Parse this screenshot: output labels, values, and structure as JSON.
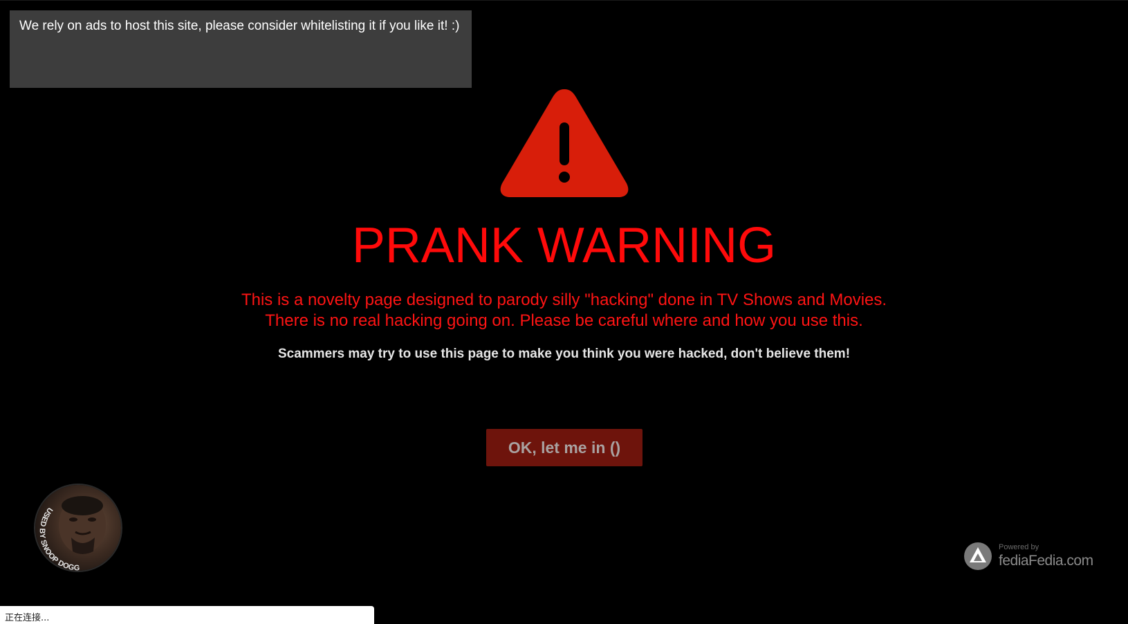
{
  "ad_notice": {
    "text": "We rely on ads to host this site, please consider whitelisting it if you like it! :)"
  },
  "warning": {
    "icon": "warning-triangle-icon",
    "title": "PRANK WARNING",
    "line1": "This is a novelty page designed to parody silly \"hacking\" done in TV Shows and Movies.",
    "line2": "There is no real hacking going on. Please be careful where and how you use this.",
    "scam_notice": "Scammers may try to use this page to make you think you were hacked, don't believe them!",
    "button_label": "OK, let me in ()"
  },
  "badge": {
    "icon": "snoop-dogg-badge",
    "text": "USED BY SNOOP DOGG"
  },
  "powered_by": {
    "icon": "fediafedia-logo-icon",
    "label": "Powered by",
    "brand": "fediaFedia.com"
  },
  "status_bar": {
    "text": "正在连接..."
  },
  "colors": {
    "background": "#000000",
    "warning_red": "#ff0a0a",
    "icon_red": "#d81e0a",
    "button_bg": "#6e140c",
    "ad_box_bg": "#3d3d3d"
  }
}
